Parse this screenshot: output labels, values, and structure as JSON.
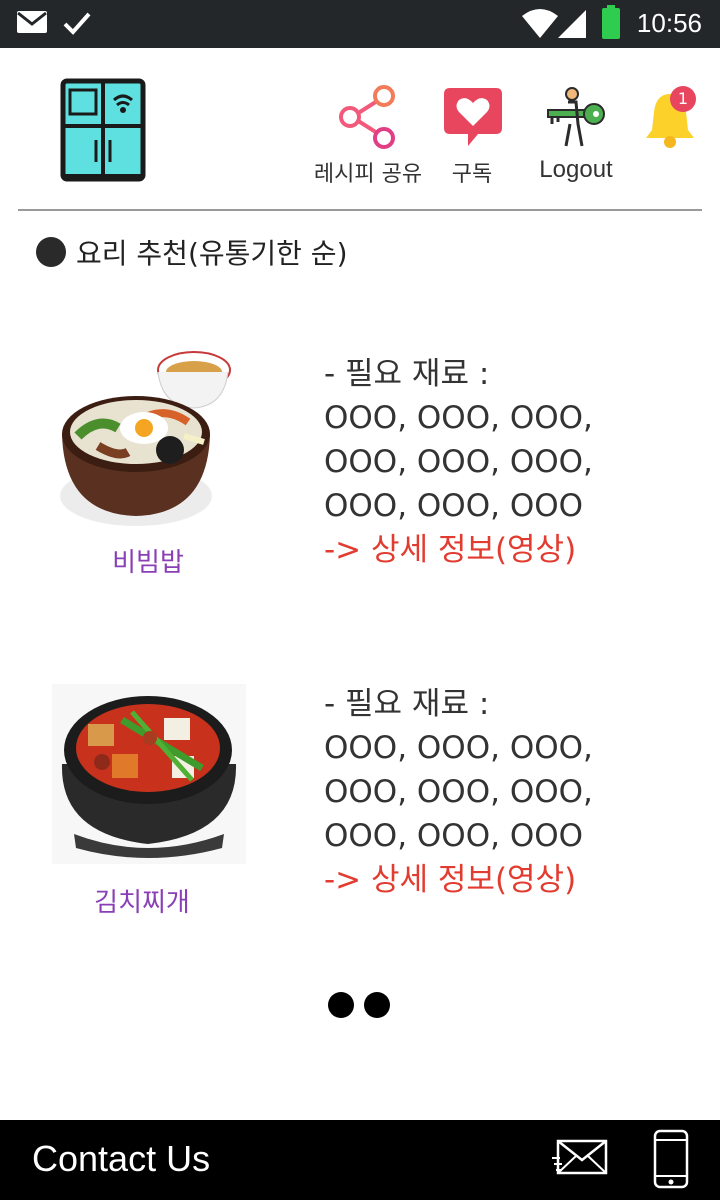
{
  "status_bar": {
    "time": "10:56"
  },
  "header": {
    "nav": {
      "share_label": "레시피 공유",
      "subscribe_label": "구독",
      "logout_label": "Logout",
      "notification_count": "1"
    }
  },
  "section": {
    "title": "요리 추천(유통기한 순)"
  },
  "recipes": [
    {
      "name": "비빔밥",
      "ingredients_label": "- 필요 재료 :",
      "ingredient_lines": [
        "OOO, OOO, OOO,",
        "OOO, OOO, OOO,",
        "OOO, OOO, OOO"
      ],
      "detail_link": "-> 상세 정보(영상)"
    },
    {
      "name": "김치찌개",
      "ingredients_label": "- 필요 재료 :",
      "ingredient_lines": [
        "OOO, OOO, OOO,",
        "OOO, OOO, OOO,",
        "OOO, OOO, OOO"
      ],
      "detail_link": "-> 상세 정보(영상)"
    }
  ],
  "footer": {
    "contact_label": "Contact Us"
  },
  "colors": {
    "accent_link": "#e23b2f",
    "recipe_name": "#8a3fb6",
    "status_bar": "#23272a",
    "footer": "#000000"
  }
}
